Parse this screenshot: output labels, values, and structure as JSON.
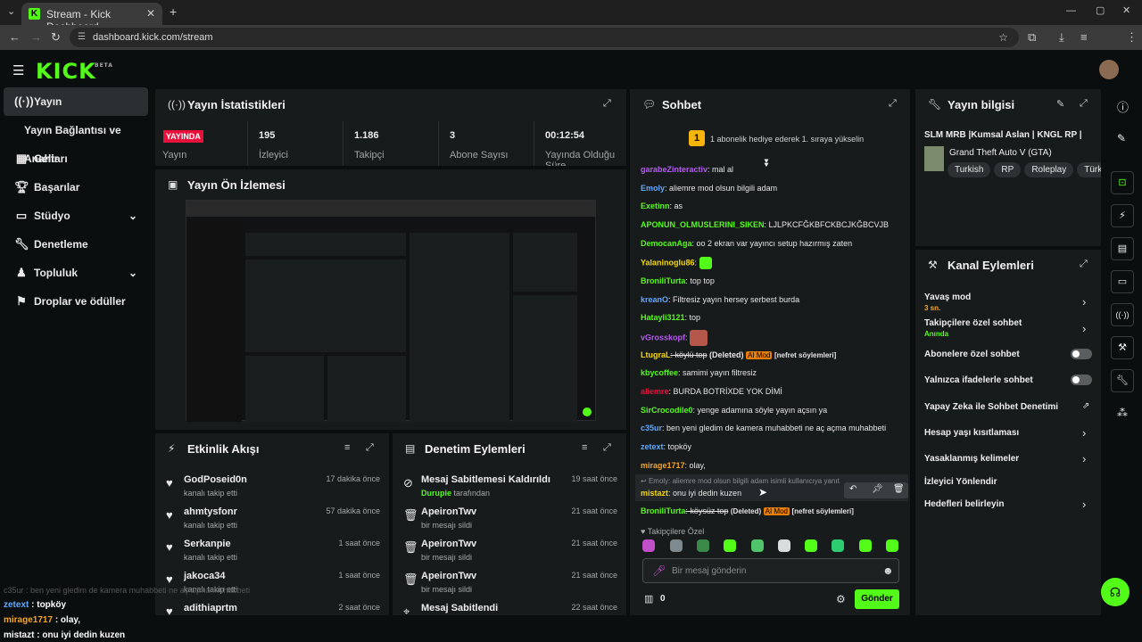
{
  "browser": {
    "tab_title": "Stream - Kick Dashboard",
    "url": "dashboard.kick.com/stream"
  },
  "header": {
    "logo": "KICK",
    "logo_sup": "BETA"
  },
  "sidebar": {
    "items": [
      {
        "label": "Yayın"
      },
      {
        "label": "Yayın Bağlantısı ve Anahtarı"
      },
      {
        "label": "Gelir"
      },
      {
        "label": "Başarılar"
      },
      {
        "label": "Stüdyo"
      },
      {
        "label": "Denetleme"
      },
      {
        "label": "Topluluk"
      },
      {
        "label": "Droplar ve ödüller"
      }
    ]
  },
  "stats": {
    "title": "Yayın İstatistikleri",
    "live_badge": "YAYINDA",
    "live_label": "Yayın",
    "items": [
      {
        "value": "195",
        "label": "İzleyici"
      },
      {
        "value": "1.186",
        "label": "Takipçi"
      },
      {
        "value": "3",
        "label": "Abone Sayısı"
      },
      {
        "value": "00:12:54",
        "label": "Yayında Olduğu Süre"
      }
    ]
  },
  "preview": {
    "title": "Yayın Ön İzlemesi"
  },
  "activity": {
    "title": "Etkinlik Akışı",
    "rows": [
      {
        "name": "GodPoseid0n",
        "sub": "kanalı takip etti",
        "time": "17 dakika önce"
      },
      {
        "name": "ahmtysfonr",
        "sub": "kanalı takip etti",
        "time": "57 dakika önce"
      },
      {
        "name": "Serkanpie",
        "sub": "kanalı takip etti",
        "time": "1 saat önce"
      },
      {
        "name": "jakoca34",
        "sub": "kanalı takip etti",
        "time": "1 saat önce"
      },
      {
        "name": "adithiaprtm",
        "sub": "",
        "time": "2 saat önce"
      }
    ]
  },
  "moderation": {
    "title": "Denetim Eylemleri",
    "rows": [
      {
        "name": "Mesaj Sabitlemesi Kaldırıldı",
        "user": "Durupie",
        "sub": "tarafından",
        "time": "19 saat önce"
      },
      {
        "name": "ApeironTwv",
        "user": "",
        "sub": "bir mesajı sildi",
        "time": "21 saat önce"
      },
      {
        "name": "ApeironTwv",
        "user": "",
        "sub": "bir mesajı sildi",
        "time": "21 saat önce"
      },
      {
        "name": "ApeironTwv",
        "user": "",
        "sub": "bir mesajı sildi",
        "time": "21 saat önce"
      },
      {
        "name": "Mesaj Sabitlendi",
        "user": "",
        "sub": "",
        "time": "22 saat önce"
      }
    ]
  },
  "chat": {
    "title": "Sohbet",
    "goal_rank": "1",
    "goal_text": "1 abonelik hediye ederek 1. sıraya yükselin",
    "messages": [
      {
        "user": "garabeZinteractiv",
        "color": "#b45bf0",
        "text": ": mal al"
      },
      {
        "user": "Emoly",
        "color": "#5fa8ff",
        "text": ": aliemre mod olsun bilgili adam"
      },
      {
        "user": "Exetinn",
        "color": "#53fc18",
        "text": ": as"
      },
      {
        "user": "APONUN_OLMUSLERINI_SIKEN",
        "color": "#53fc18",
        "text": ": LJLPKCFĞKBFCKBCJKĞBCVJB"
      },
      {
        "user": "DemocanAga",
        "color": "#53fc18",
        "text": ": oo 2 ekran var yayıncı setup hazırmış zaten"
      },
      {
        "user": "Yalaninoglu86",
        "color": "#f5d90a",
        "text": ":"
      },
      {
        "user": "BroniliTurta",
        "color": "#53fc18",
        "text": ": top top"
      },
      {
        "user": "kreanO",
        "color": "#5fa8ff",
        "text": ": Filtresiz yayın hersey serbest burda"
      },
      {
        "user": "Hatayli3121",
        "color": "#53fc18",
        "text": ": top"
      },
      {
        "user": "vGrosskopf",
        "color": "#b45bf0",
        "text": ":"
      },
      {
        "user": "LtugraL",
        "color": "#f5d90a",
        "text": ": köylü top"
      },
      {
        "user": "kbycoffee",
        "color": "#53fc18",
        "text": ": samimi yayın filtresiz"
      },
      {
        "user": "aliemre",
        "color": "#e9113c",
        "text": ": BURDA BOTRİXDE YOK DİMİ"
      },
      {
        "user": "SirCrocodile0",
        "color": "#53fc18",
        "text": ": yenge adamına söyle yayın açsın ya"
      },
      {
        "user": "c35ur",
        "color": "#5fa8ff",
        "text": ": ben yeni gledim de kamera muhabbeti ne aç açma muhabbeti"
      },
      {
        "user": "zetext",
        "color": "#5fa8ff",
        "text": ": topköy"
      },
      {
        "user": "mirage1717",
        "color": "#f5a623",
        "text": ": olay,"
      }
    ],
    "reply_to": "Emoly: aliemre mod olsun bilgili adam isimli kullanıcıya yanıt",
    "reply_user": "mistazt",
    "reply_text": ": onu iyi dedin kuzen",
    "last_user": "BroniliTurta",
    "last_text": ": köysüz top",
    "deleted_label": "(Deleted)",
    "ai_mod": "AI Mod",
    "reason": "[nefret söylemleri]",
    "followers_only": "Takipçilere Özel",
    "input_placeholder": "Bir mesaj gönderin",
    "points": "0",
    "send_label": "Gönder"
  },
  "stream_info": {
    "title": "Yayın bilgisi",
    "stream_title": "SLM MRB |Kumsal Aslan | KNGL RP |",
    "category": "Grand Theft Auto V (GTA)",
    "tags": [
      "Turkish",
      "RP",
      "Roleplay",
      "Türkç"
    ]
  },
  "channel_actions": {
    "title": "Kanal Eylemleri",
    "slow_mode": "Yavaş mod",
    "slow_mode_value": "3 sn.",
    "followers_chat": "Takipçilere özel sohbet",
    "followers_chat_value": "Anında",
    "subs_chat": "Abonelere özel sohbet",
    "emote_chat": "Yalnızca ifadelerle sohbet",
    "ai_moderation": "Yapay Zeka ile Sohbet Denetimi",
    "age_limits": "Hesap yaşı kısıtlaması",
    "banned_words": "Yasaklanmış kelimeler",
    "raid": "İzleyici Yönlendir",
    "goals": "Hedefleri belirleyin"
  },
  "overlay": {
    "faded": "c35ur : ben yeni gledim de kamera muhabbeti ne aç açma muhabbeti",
    "lines": [
      {
        "user": "zetext",
        "text": " : topköy",
        "color": "#5fa8ff"
      },
      {
        "user": "mirage1717",
        "text": " : olay,",
        "color": "#f5a623"
      },
      {
        "user": "mistazt",
        "text": " : onu iyi dedin kuzen",
        "color": "#ffffff"
      }
    ]
  },
  "colors": {
    "brand": "#53fc18",
    "live": "#e9113c",
    "panel": "#181b1c",
    "bg": "#0b0e0f"
  }
}
